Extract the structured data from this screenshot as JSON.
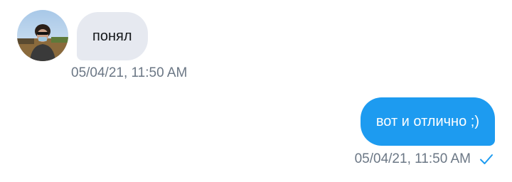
{
  "conversation": {
    "messages": [
      {
        "direction": "incoming",
        "text": "понял",
        "timestamp": "05/04/21, 11:50 AM",
        "avatar_icon": "user-avatar-photo"
      },
      {
        "direction": "outgoing",
        "text": "вот и отлично ;)",
        "timestamp": "05/04/21, 11:50 AM",
        "status_icon": "read-check-icon"
      }
    ]
  },
  "colors": {
    "incoming_bubble": "#e6e9f0",
    "outgoing_bubble": "#1d9bf0",
    "timestamp_text": "#6b7785",
    "check_mark": "#1d9bf0"
  }
}
